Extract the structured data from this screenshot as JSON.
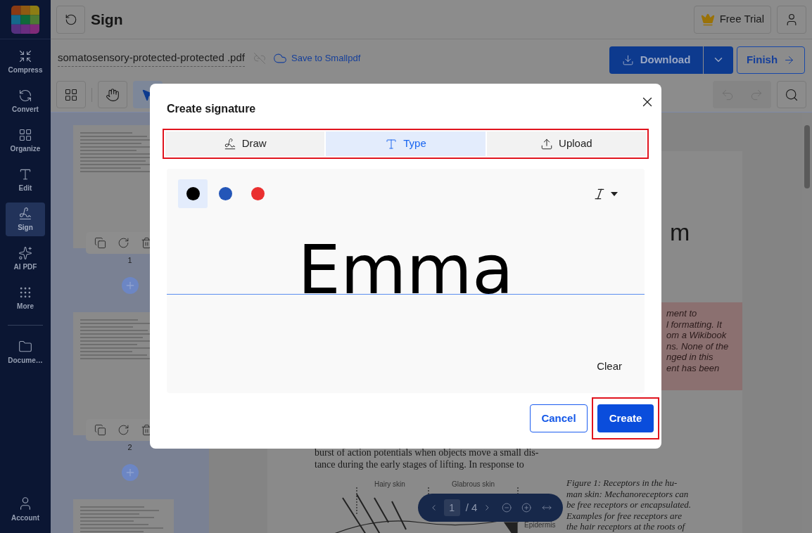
{
  "sidebar": {
    "items": [
      {
        "kind": "compress",
        "label": "Compress",
        "selected": false
      },
      {
        "kind": "convert",
        "label": "Convert",
        "selected": false
      },
      {
        "kind": "organize",
        "label": "Organize",
        "selected": false
      },
      {
        "kind": "edit",
        "label": "Edit",
        "selected": false
      },
      {
        "kind": "sign",
        "label": "Sign",
        "selected": true
      },
      {
        "kind": "ai",
        "label": "AI PDF",
        "selected": false
      },
      {
        "kind": "more",
        "label": "More",
        "selected": false
      },
      {
        "kind": "documents",
        "label": "Docume…",
        "selected": false
      }
    ],
    "account": "Account"
  },
  "header": {
    "title": "Sign",
    "free_trial": "Free Trial"
  },
  "file": {
    "name": "somatosensory-protected-protected .pdf",
    "save_link": "Save to Smallpdf"
  },
  "actions": {
    "download": "Download",
    "finish": "Finish"
  },
  "toolbar": {
    "tools": [
      {
        "kind": "grid",
        "selected": false
      },
      {
        "kind": "hand",
        "selected": false
      },
      {
        "kind": "pointer",
        "selected": true
      }
    ]
  },
  "thumbnails": [
    {
      "kind": "full",
      "number": "1"
    },
    {
      "kind": "full",
      "number": "2"
    },
    {
      "kind": "cut"
    }
  ],
  "document": {
    "title_fragment": "m",
    "notice_lines": [
      "ment to",
      "l formatting. It",
      "om a Wikibook",
      "ns. None of the",
      "nged in this",
      "ent has been"
    ],
    "body_lines": [
      "burst of action potentials when objects move a small dis-",
      "tance during the early stages of lifting. In response to"
    ],
    "figure_labels": [
      "Hairy skin",
      "Glabrous skin",
      "Epidermis"
    ],
    "caption_lines": [
      "Figure 1:  Receptors in the hu-",
      "man skin: Mechanoreceptors can",
      "be free receptors or encapsulated.",
      "Examples for free receptors are",
      "the hair receptors at the roots of"
    ]
  },
  "pager": {
    "page": "1",
    "total": "/ 4"
  },
  "modal": {
    "title": "Create signature",
    "tabs": [
      {
        "kind": "draw",
        "label": "Draw",
        "selected": false
      },
      {
        "kind": "type",
        "label": "Type",
        "selected": true
      },
      {
        "kind": "upload",
        "label": "Upload",
        "selected": false
      }
    ],
    "colors": [
      {
        "color": "#000000",
        "selected": true
      },
      {
        "color": "#2456b8",
        "selected": false
      },
      {
        "color": "#ea3030",
        "selected": false
      }
    ],
    "signature": "Emma",
    "clear": "Clear",
    "cancel": "Cancel",
    "create": "Create"
  }
}
